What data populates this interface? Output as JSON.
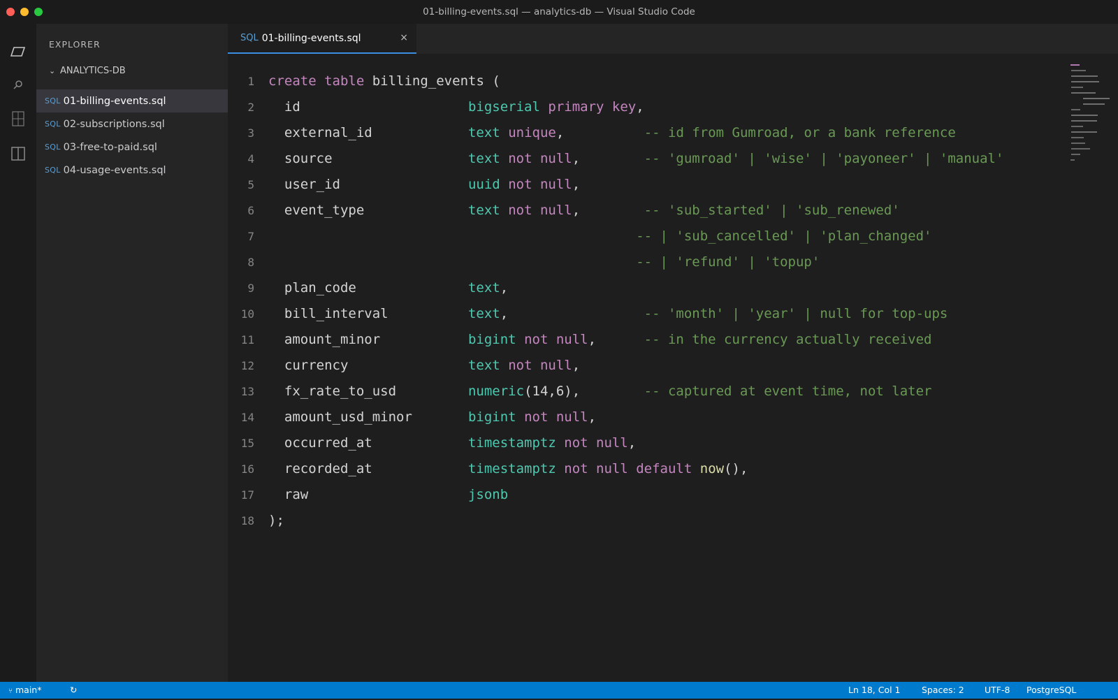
{
  "window": {
    "title": "01-billing-events.sql — analytics-db — Visual Studio Code",
    "traffic_colors": [
      "#ff5f57",
      "#febc2e",
      "#28c840"
    ]
  },
  "activity_bar": {
    "icons": [
      "explorer-icon",
      "search-icon",
      "source-control-icon",
      "split-editor-icon"
    ]
  },
  "sidebar": {
    "title": "EXPLORER",
    "folder": "ANALYTICS-DB",
    "files": [
      {
        "tag": "SQL",
        "name": "01-billing-events.sql"
      },
      {
        "tag": "SQL",
        "name": "02-subscriptions.sql"
      },
      {
        "tag": "SQL",
        "name": "03-free-to-paid.sql"
      },
      {
        "tag": "SQL",
        "name": "04-usage-events.sql"
      }
    ]
  },
  "tab": {
    "tag": "SQL",
    "label": "01-billing-events.sql",
    "close": "×"
  },
  "editor": {
    "lines": [
      {
        "n": "1",
        "tokens": [
          [
            "kw",
            "create"
          ],
          [
            "t",
            " "
          ],
          [
            "kw",
            "table"
          ],
          [
            "id",
            " billing_events ("
          ]
        ]
      },
      {
        "n": "2",
        "tokens": [
          [
            "id",
            "  id                     "
          ],
          [
            "type",
            "bigserial"
          ],
          [
            "t",
            " "
          ],
          [
            "kw",
            "primary key"
          ],
          [
            "id",
            ","
          ]
        ]
      },
      {
        "n": "3",
        "tokens": [
          [
            "id",
            "  external_id            "
          ],
          [
            "type",
            "text"
          ],
          [
            "t",
            " "
          ],
          [
            "kw",
            "unique"
          ],
          [
            "id",
            ",          "
          ],
          [
            "cmt",
            "-- id from Gumroad, or a bank reference"
          ]
        ]
      },
      {
        "n": "4",
        "tokens": [
          [
            "id",
            "  source                 "
          ],
          [
            "type",
            "text"
          ],
          [
            "t",
            " "
          ],
          [
            "kw",
            "not null"
          ],
          [
            "id",
            ",        "
          ],
          [
            "cmt",
            "-- 'gumroad' | 'wise' | 'payoneer' | 'manual'"
          ]
        ]
      },
      {
        "n": "5",
        "tokens": [
          [
            "id",
            "  user_id                "
          ],
          [
            "type",
            "uuid"
          ],
          [
            "t",
            " "
          ],
          [
            "kw",
            "not null"
          ],
          [
            "id",
            ","
          ]
        ]
      },
      {
        "n": "6",
        "tokens": [
          [
            "id",
            "  event_type             "
          ],
          [
            "type",
            "text"
          ],
          [
            "t",
            " "
          ],
          [
            "kw",
            "not null"
          ],
          [
            "id",
            ",        "
          ],
          [
            "cmt",
            "-- 'sub_started' | 'sub_renewed'"
          ]
        ]
      },
      {
        "n": "7",
        "tokens": [
          [
            "t",
            "                                              "
          ],
          [
            "cmt",
            "-- | 'sub_cancelled' | 'plan_changed'"
          ]
        ]
      },
      {
        "n": "8",
        "tokens": [
          [
            "t",
            "                                              "
          ],
          [
            "cmt",
            "-- | 'refund' | 'topup'"
          ]
        ]
      },
      {
        "n": "9",
        "tokens": [
          [
            "id",
            "  plan_code              "
          ],
          [
            "type",
            "text"
          ],
          [
            "id",
            ","
          ]
        ]
      },
      {
        "n": "10",
        "tokens": [
          [
            "id",
            "  bill_interval          "
          ],
          [
            "type",
            "text"
          ],
          [
            "id",
            ",                 "
          ],
          [
            "cmt",
            "-- 'month' | 'year' | null for top-ups"
          ]
        ]
      },
      {
        "n": "11",
        "tokens": [
          [
            "id",
            "  amount_minor           "
          ],
          [
            "type",
            "bigint"
          ],
          [
            "t",
            " "
          ],
          [
            "kw",
            "not null"
          ],
          [
            "id",
            ",      "
          ],
          [
            "cmt",
            "-- in the currency actually received"
          ]
        ]
      },
      {
        "n": "12",
        "tokens": [
          [
            "id",
            "  currency               "
          ],
          [
            "type",
            "text"
          ],
          [
            "t",
            " "
          ],
          [
            "kw",
            "not null"
          ],
          [
            "id",
            ","
          ]
        ]
      },
      {
        "n": "13",
        "tokens": [
          [
            "id",
            "  fx_rate_to_usd         "
          ],
          [
            "type",
            "numeric"
          ],
          [
            "id",
            "(14,6),        "
          ],
          [
            "cmt",
            "-- captured at event time, not later"
          ]
        ]
      },
      {
        "n": "14",
        "tokens": [
          [
            "id",
            "  amount_usd_minor       "
          ],
          [
            "type",
            "bigint"
          ],
          [
            "t",
            " "
          ],
          [
            "kw",
            "not null"
          ],
          [
            "id",
            ","
          ]
        ]
      },
      {
        "n": "15",
        "tokens": [
          [
            "id",
            "  occurred_at            "
          ],
          [
            "type",
            "timestamptz"
          ],
          [
            "t",
            " "
          ],
          [
            "kw",
            "not null"
          ],
          [
            "id",
            ","
          ]
        ]
      },
      {
        "n": "16",
        "tokens": [
          [
            "id",
            "  recorded_at            "
          ],
          [
            "type",
            "timestamptz"
          ],
          [
            "t",
            " "
          ],
          [
            "kw",
            "not null default"
          ],
          [
            "t",
            " "
          ],
          [
            "fn",
            "now"
          ],
          [
            "id",
            "(),"
          ]
        ]
      },
      {
        "n": "17",
        "tokens": [
          [
            "id",
            "  raw                    "
          ],
          [
            "type",
            "jsonb"
          ]
        ]
      },
      {
        "n": "18",
        "tokens": [
          [
            "id",
            ");"
          ]
        ]
      }
    ]
  },
  "statusbar": {
    "branch": "main*",
    "sync": "↻",
    "position": "Ln 18, Col 1",
    "spaces": "Spaces: 2",
    "encoding": "UTF-8",
    "language": "PostgreSQL"
  }
}
